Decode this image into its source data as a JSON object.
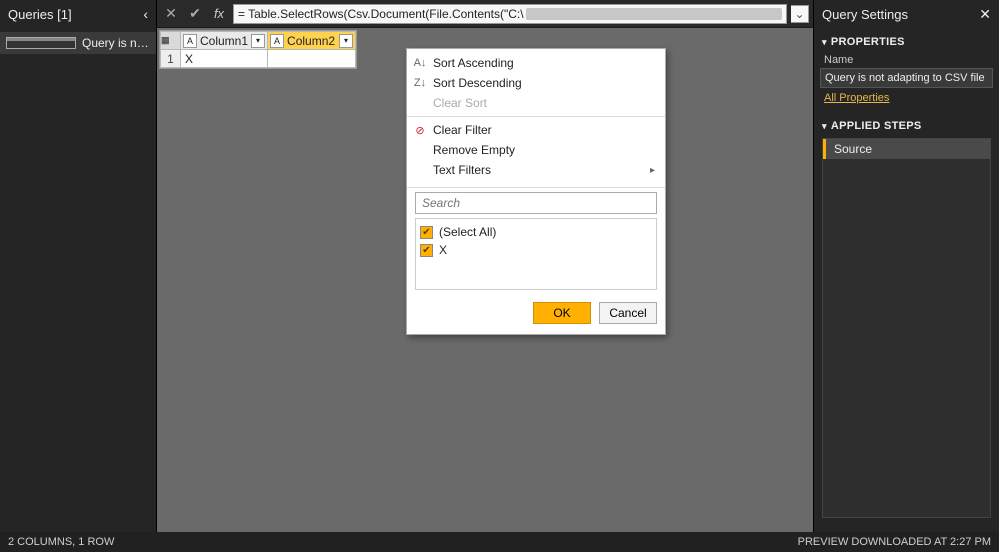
{
  "queries_pane": {
    "title": "Queries [1]",
    "items": [
      {
        "label": "Query is not adapting to CS..."
      }
    ]
  },
  "formula_bar": {
    "text": "= Table.SelectRows(Csv.Document(File.Contents(\"C:\\"
  },
  "grid": {
    "columns": [
      {
        "name": "Column1",
        "type_label": "ABC",
        "active": false
      },
      {
        "name": "Column2",
        "type_label": "ABC",
        "active": true
      }
    ],
    "rows": [
      {
        "n": "1",
        "cells": [
          "X",
          ""
        ]
      }
    ]
  },
  "filter_menu": {
    "sort_asc": "Sort Ascending",
    "sort_desc": "Sort Descending",
    "clear_sort": "Clear Sort",
    "clear_filter": "Clear Filter",
    "remove_empty": "Remove Empty",
    "text_filters": "Text Filters",
    "search_placeholder": "Search",
    "options": [
      {
        "label": "(Select All)",
        "checked": true
      },
      {
        "label": "X",
        "checked": true
      }
    ],
    "ok": "OK",
    "cancel": "Cancel"
  },
  "settings_pane": {
    "title": "Query Settings",
    "properties_title": "PROPERTIES",
    "name_label": "Name",
    "name_value": "Query is not adapting to CSV file headers",
    "all_properties": "All Properties",
    "applied_steps_title": "APPLIED STEPS",
    "steps": [
      {
        "label": "Source"
      }
    ]
  },
  "status_bar": {
    "left": "2 COLUMNS, 1 ROW",
    "right": "PREVIEW DOWNLOADED AT 2:27 PM"
  }
}
